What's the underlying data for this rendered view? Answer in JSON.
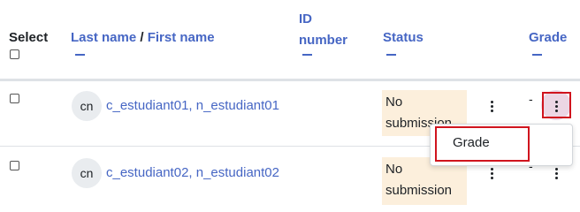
{
  "header": {
    "select_label": "Select",
    "lastname_label": "Last name",
    "name_separator": " / ",
    "firstname_label": "First name",
    "idnumber_line1": "ID",
    "idnumber_line2": "number",
    "status_label": "Status",
    "grade_label": "Grade"
  },
  "rows": [
    {
      "initials": "cn",
      "fullname": "c_estudiant01, n_estudiant01",
      "status_line1": "No",
      "status_line2": "submission",
      "grade": "-"
    },
    {
      "initials": "cn",
      "fullname": "c_estudiant02, n_estudiant02",
      "status_line1": "No",
      "status_line2": "submission",
      "grade": "-"
    }
  ],
  "menu": {
    "items": [
      "Grade"
    ]
  },
  "colors": {
    "link": "#4666c4",
    "status_bg": "#fcefdc",
    "highlight": "#d0141e"
  },
  "icons": {
    "row_actions": "vertical-ellipsis-icon",
    "grade_actions": "vertical-ellipsis-icon"
  }
}
